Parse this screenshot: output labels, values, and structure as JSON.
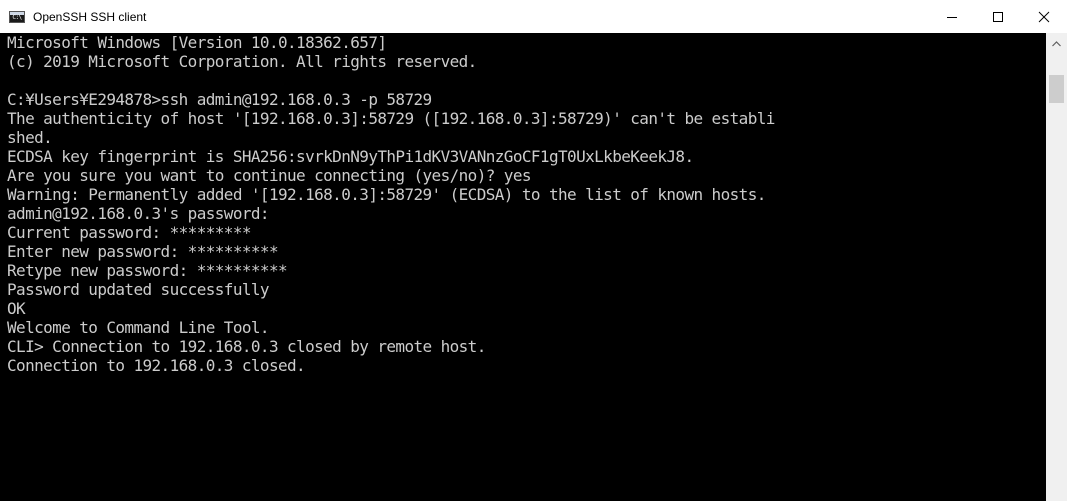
{
  "window": {
    "title": "OpenSSH SSH client",
    "icon_label": "C:\\",
    "icons": {
      "app": "console-app-icon",
      "minimize": "minimize-icon",
      "maximize": "maximize-icon",
      "close": "close-icon",
      "scroll_up": "chevron-up-icon"
    }
  },
  "colors": {
    "terminal_background": "#000000",
    "terminal_text": "#cccccc",
    "titlebar_background": "#ffffff",
    "scrollbar_track": "#f0f0f0",
    "scrollbar_thumb": "#cdcdcd"
  },
  "terminal": {
    "lines": [
      "Microsoft Windows [Version 10.0.18362.657]",
      "(c) 2019 Microsoft Corporation. All rights reserved.",
      "",
      "C:¥Users¥E294878>ssh admin@192.168.0.3 -p 58729",
      "The authenticity of host '[192.168.0.3]:58729 ([192.168.0.3]:58729)' can't be establi",
      "shed.",
      "ECDSA key fingerprint is SHA256:svrkDnN9yThPi1dKV3VANnzGoCF1gT0UxLkbeKeekJ8.",
      "Are you sure you want to continue connecting (yes/no)? yes",
      "Warning: Permanently added '[192.168.0.3]:58729' (ECDSA) to the list of known hosts.",
      "admin@192.168.0.3's password:",
      "Current password: *********",
      "Enter new password: **********",
      "Retype new password: **********",
      "Password updated successfully",
      "OK",
      "Welcome to Command Line Tool.",
      "CLI> Connection to 192.168.0.3 closed by remote host.",
      "Connection to 192.168.0.3 closed."
    ]
  }
}
